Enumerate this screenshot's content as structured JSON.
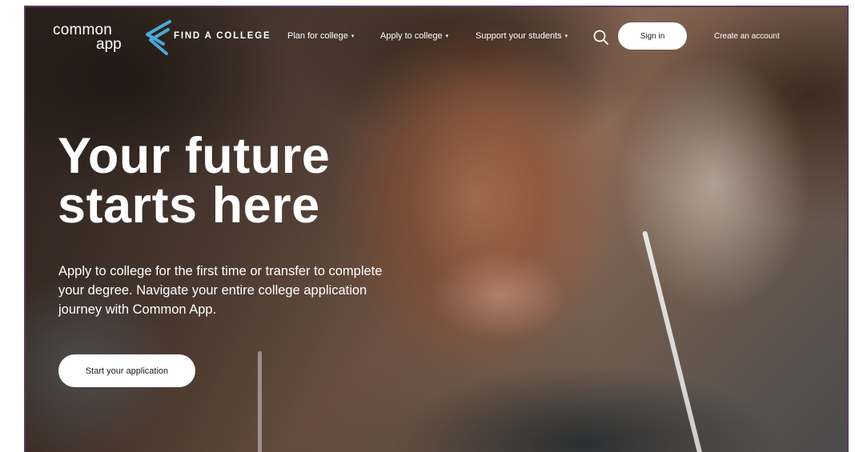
{
  "header": {
    "logo": {
      "line1": "common",
      "line2": "app",
      "accent": "#4aa8d8"
    },
    "find_college": "FIND A COLLEGE",
    "nav": [
      {
        "label": "Plan for college",
        "caret": "▾"
      },
      {
        "label": "Apply to college",
        "caret": "▾"
      },
      {
        "label": "Support your students",
        "caret": "▾"
      }
    ],
    "search_icon": "search-icon",
    "sign_in": "Sign in",
    "create_account": "Create an account"
  },
  "hero": {
    "headline_line1": "Your future",
    "headline_line2": "starts here",
    "subtext": "Apply to college for the first time or transfer to complete your degree. Navigate your entire college application journey with Common App.",
    "cta": "Start your application"
  },
  "colors": {
    "frame": "#5b3b63",
    "button_bg": "#ffffff",
    "text_on_hero": "#ffffff"
  }
}
